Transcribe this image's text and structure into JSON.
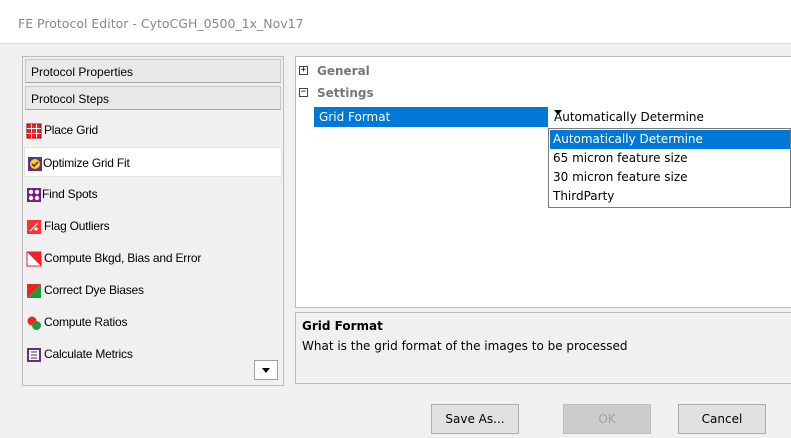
{
  "window": {
    "title": "FE Protocol Editor - CytoCGH_0500_1x_Nov17"
  },
  "left_panel": {
    "protocol_properties_label": "Protocol Properties",
    "protocol_steps_label": "Protocol Steps",
    "steps": [
      {
        "label": "Place Grid",
        "icon": "grid-icon"
      },
      {
        "label": "Optimize Grid Fit",
        "icon": "optimize-icon",
        "selected": true
      },
      {
        "label": "Find Spots",
        "icon": "spots-icon"
      },
      {
        "label": "Flag Outliers",
        "icon": "flag-icon"
      },
      {
        "label": "Compute Bkgd, Bias and Error",
        "icon": "bkgd-icon"
      },
      {
        "label": "Correct Dye Biases",
        "icon": "dye-icon"
      },
      {
        "label": "Compute Ratios",
        "icon": "ratios-icon"
      },
      {
        "label": "Calculate Metrics",
        "icon": "metrics-icon"
      }
    ]
  },
  "property_grid": {
    "categories": [
      {
        "name": "General",
        "toggle": "+"
      },
      {
        "name": "Settings",
        "toggle": "−"
      }
    ],
    "property": {
      "name": "Grid Format",
      "value": "Automatically Determine"
    },
    "dropdown_options": [
      "Automatically Determine",
      "65 micron feature size",
      "30 micron feature size",
      "ThirdParty"
    ],
    "selected_option_index": 0
  },
  "description": {
    "title": "Grid Format",
    "text": "What is the grid format of the images to be processed"
  },
  "buttons": {
    "save_as": "Save As...",
    "ok": "OK",
    "cancel": "Cancel"
  },
  "colors": {
    "selection": "#0078d7"
  }
}
